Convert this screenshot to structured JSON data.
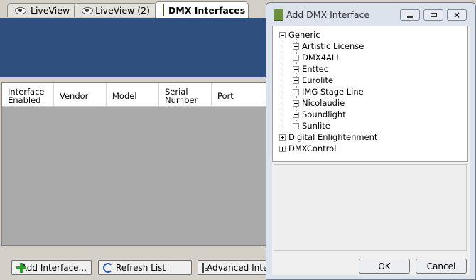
{
  "tabs": [
    {
      "label": "LiveView",
      "icon": "eye-icon"
    },
    {
      "label": "LiveView (2)",
      "icon": "eye-icon"
    },
    {
      "label": "DMX Interfaces",
      "icon": "dmx-interface-icon",
      "active": true
    }
  ],
  "table": {
    "columns": [
      "Interface Enabled",
      "Vendor",
      "Model",
      "Serial Number",
      "Port"
    ]
  },
  "toolbar": {
    "add_label": "Add Interface...",
    "refresh_label": "Refresh List",
    "advanced_label": "Advanced Inter"
  },
  "dialog": {
    "title": "Add DMX Interface",
    "tree": {
      "generic": {
        "label": "Generic",
        "children": [
          "Artistic License",
          "DMX4ALL",
          "Enttec",
          "Eurolite",
          "IMG Stage Line",
          "Nicolaudie",
          "Soundlight",
          "Sunlite"
        ]
      },
      "digital_enlightenment": "Digital Enlightenment",
      "dmxcontrol": "DMXControl"
    },
    "ok_label": "OK",
    "cancel_label": "Cancel"
  },
  "colors": {
    "header_blue": "#2f4f7f",
    "grid_gray": "#aaaaaa",
    "plus_green": "#2e9e2e"
  }
}
